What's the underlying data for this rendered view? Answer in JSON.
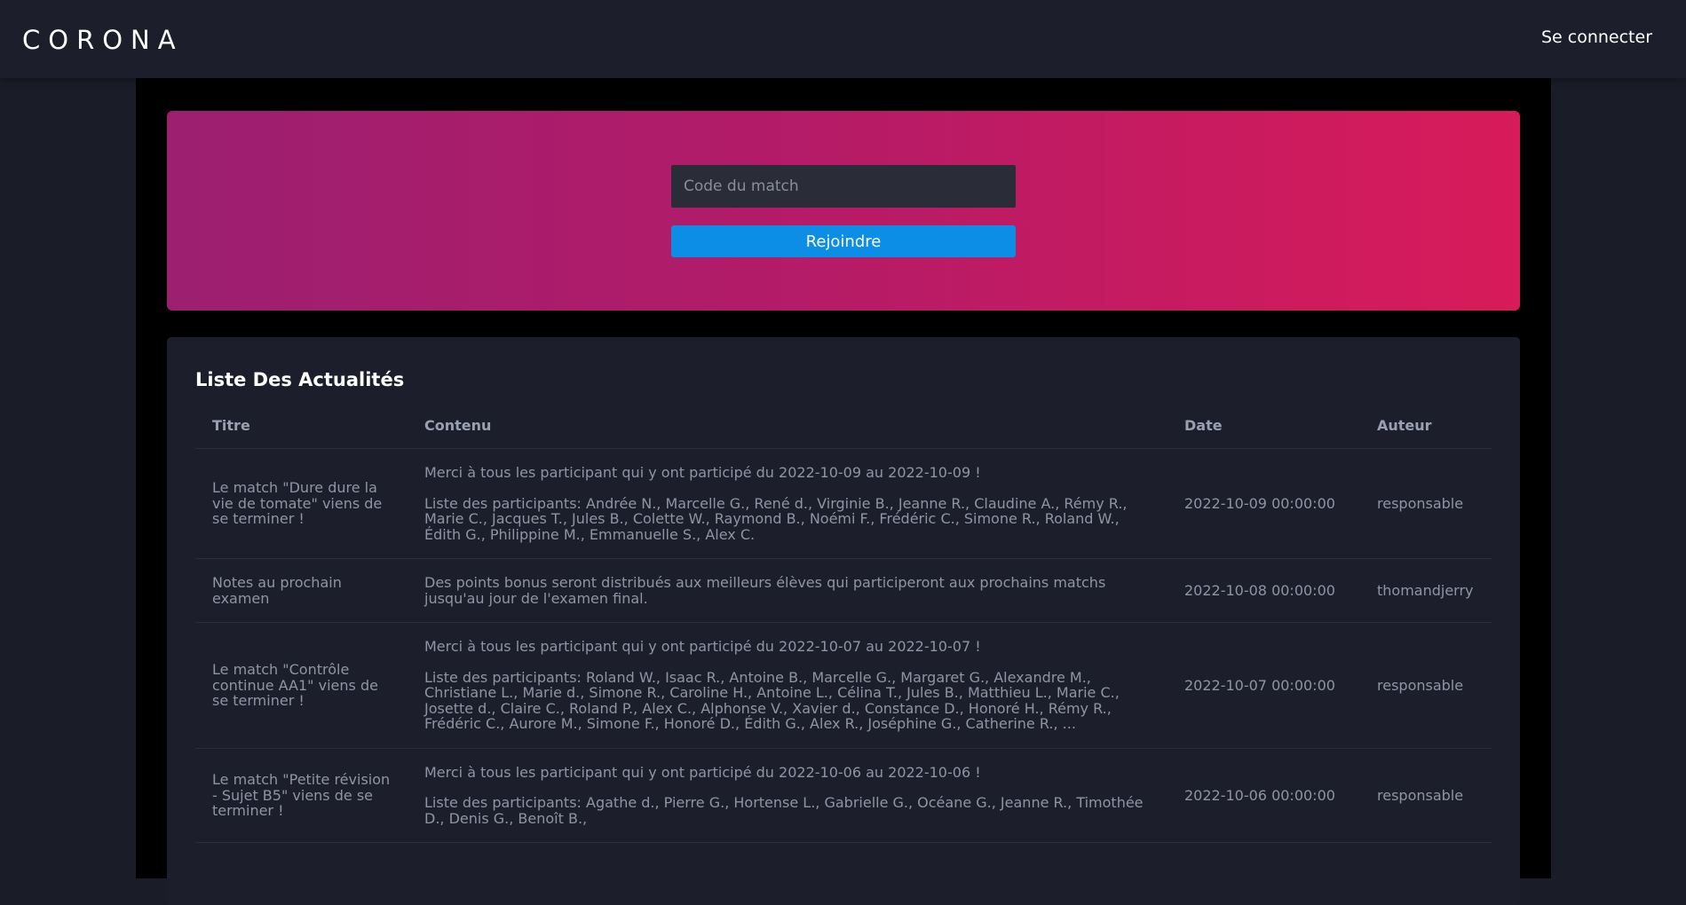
{
  "header": {
    "brand": "CORONA",
    "login_label": "Se connecter"
  },
  "hero": {
    "code_placeholder": "Code du match",
    "join_label": "Rejoindre"
  },
  "news": {
    "title": "Liste Des Actualités",
    "columns": {
      "title": "Titre",
      "content": "Contenu",
      "date": "Date",
      "author": "Auteur"
    },
    "rows": [
      {
        "title": "Le match \"Dure dure la vie de tomate\" viens de se terminer !",
        "content_line1": "Merci à tous les participant qui y ont participé du 2022-10-09 au 2022-10-09 !",
        "content_line2": "Liste des participants: Andrée N., Marcelle G., René d., Virginie B., Jeanne R., Claudine A., Rémy R., Marie C., Jacques T., Jules B., Colette W., Raymond B., Noémi F., Frédéric C., Simone R., Roland W., Édith G., Philippine M., Emmanuelle S., Alex C.",
        "date": "2022-10-09 00:00:00",
        "author": "responsable"
      },
      {
        "title": "Notes au prochain examen",
        "content_line1": "Des points bonus seront distribués aux meilleurs élèves qui participeront aux prochains matchs jusqu'au jour de l'examen final.",
        "content_line2": "",
        "date": "2022-10-08 00:00:00",
        "author": "thomandjerry"
      },
      {
        "title": "Le match \"Contrôle continue AA1\" viens de se terminer !",
        "content_line1": "Merci à tous les participant qui y ont participé du 2022-10-07 au 2022-10-07 !",
        "content_line2": "Liste des participants: Roland W., Isaac R., Antoine B., Marcelle G., Margaret G., Alexandre M., Christiane L., Marie d., Simone R., Caroline H., Antoine L., Célina T., Jules B., Matthieu L., Marie C., Josette d., Claire C., Roland P., Alex C., Alphonse V., Xavier d., Constance D., Honoré H., Rémy R., Frédéric C., Aurore M., Simone F., Honoré D., Édith G., Alex R., Joséphine G., Catherine R., ...",
        "date": "2022-10-07 00:00:00",
        "author": "responsable"
      },
      {
        "title": "Le match \"Petite révision - Sujet B5\" viens de se terminer !",
        "content_line1": "Merci à tous les participant qui y ont participé du 2022-10-06 au 2022-10-06 !",
        "content_line2": "Liste des participants: Agathe d., Pierre G., Hortense L., Gabrielle G., Océane G., Jeanne R., Timothée D., Denis G., Benoît B.,",
        "date": "2022-10-06 00:00:00",
        "author": "responsable"
      }
    ]
  }
}
